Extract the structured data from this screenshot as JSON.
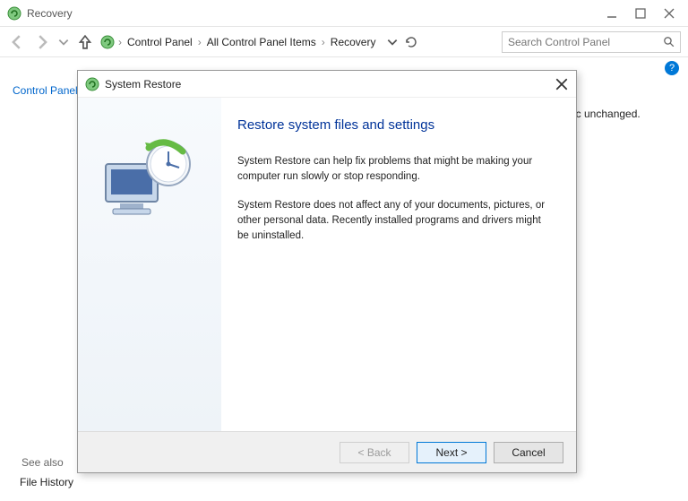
{
  "window": {
    "title": "Recovery"
  },
  "breadcrumb": {
    "items": [
      "Control Panel",
      "All Control Panel Items",
      "Recovery"
    ]
  },
  "search": {
    "placeholder": "Search Control Panel"
  },
  "leftpanel": {
    "home": "Control Panel Home"
  },
  "background": {
    "partial_text": "ic unchanged."
  },
  "see_also": {
    "label": "See also",
    "file_history": "File History"
  },
  "dialog": {
    "title": "System Restore",
    "heading": "Restore system files and settings",
    "para1": "System Restore can help fix problems that might be making your computer run slowly or stop responding.",
    "para2": "System Restore does not affect any of your documents, pictures, or other personal data. Recently installed programs and drivers might be uninstalled.",
    "buttons": {
      "back": "< Back",
      "next": "Next >",
      "cancel": "Cancel"
    }
  }
}
